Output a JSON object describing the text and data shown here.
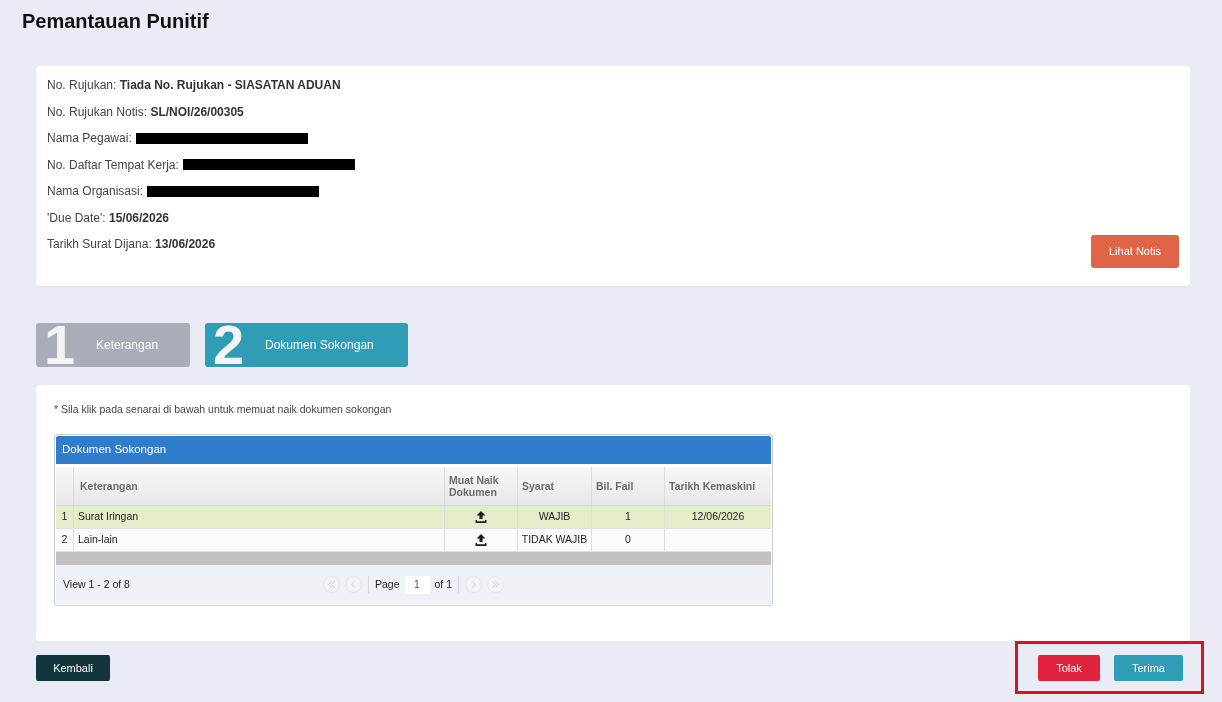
{
  "page_title": "Pemantauan Punitif",
  "info": {
    "fields": [
      {
        "label": "No. Rujukan:",
        "value": "Tiada No. Rujukan - SIASATAN ADUAN",
        "redacted": false
      },
      {
        "label": "No. Rujukan Notis:",
        "value": "SL/NOI/26/00305",
        "redacted": false
      },
      {
        "label": "Nama Pegawai:",
        "redacted": true
      },
      {
        "label": "No. Daftar Tempat Kerja:",
        "redacted": true
      },
      {
        "label": "Nama Organisasi:",
        "redacted": true
      },
      {
        "label": "'Due Date':",
        "value": "15/06/2026",
        "redacted": false
      },
      {
        "label": "Tarikh Surat Dijana:",
        "value": "13/06/2026",
        "redacted": false
      }
    ],
    "button": "Lihat Notis"
  },
  "steps": [
    {
      "number": "1",
      "label": "Keterangan",
      "selected": false
    },
    {
      "number": "2",
      "label": "Dokumen Sokongan",
      "selected": true
    }
  ],
  "documents": {
    "note_marker": "*",
    "note": "Sila klik pada senarai di bawah untuk memuat naik dokumen sokongan",
    "grid": {
      "caption": "Dokumen Sokongan",
      "columns": [
        "Keterangan",
        "Muat Naik Dokumen",
        "Syarat",
        "Bil. Fail",
        "Tarikh Kemaskini"
      ],
      "rows": [
        {
          "number": "1",
          "keterangan": "Surat Iringan",
          "syarat": "WAJIB",
          "bil_fail": "1",
          "tarikh": "12/06/2026",
          "selected": true
        },
        {
          "number": "2",
          "keterangan": "Lain-lain",
          "syarat": "TIDAK WAJIB",
          "bil_fail": "0",
          "selected": false
        }
      ],
      "pager": {
        "summary": "View 1 - 2 of 8",
        "page_label": "Page",
        "page_value": "1",
        "of_label": "of 1",
        "nav": [
          {
            "kind": "first",
            "disabled": true
          },
          {
            "kind": "prev",
            "disabled": true
          },
          {
            "kind": "next",
            "disabled": true
          },
          {
            "kind": "last",
            "disabled": true
          }
        ]
      }
    }
  },
  "footer": {
    "back_button": "Kembali",
    "actions": {
      "highlighted": true,
      "buttons": [
        {
          "kind": "reject",
          "label": "Tolak"
        },
        {
          "kind": "accept",
          "label": "Terima"
        }
      ]
    }
  }
}
